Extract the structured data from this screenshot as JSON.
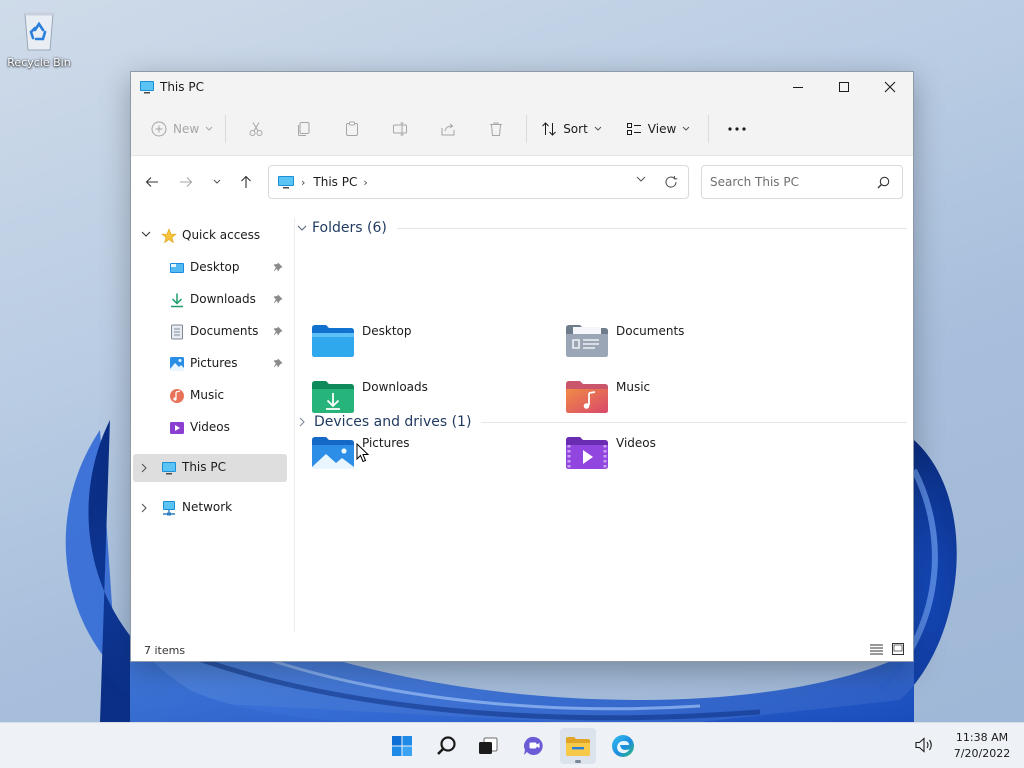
{
  "desktop": {
    "recycle_bin_label": "Recycle Bin"
  },
  "window": {
    "title": "This PC",
    "toolbar": {
      "new_label": "New",
      "sort_label": "Sort",
      "view_label": "View",
      "disabled_icons": [
        "cut-icon",
        "copy-icon",
        "paste-icon",
        "rename-icon",
        "share-icon",
        "delete-icon"
      ]
    },
    "address": {
      "crumb": "This PC",
      "search_placeholder": "Search This PC"
    },
    "navpane": {
      "quick_access": "Quick access",
      "items": [
        {
          "label": "Desktop",
          "pinned": true
        },
        {
          "label": "Downloads",
          "pinned": true
        },
        {
          "label": "Documents",
          "pinned": true
        },
        {
          "label": "Pictures",
          "pinned": true
        },
        {
          "label": "Music",
          "pinned": false
        },
        {
          "label": "Videos",
          "pinned": false
        }
      ],
      "this_pc": "This PC",
      "network": "Network"
    },
    "content": {
      "folders_header": "Folders (6)",
      "folders": [
        {
          "name": "Desktop",
          "icon": "desktop-folder-icon"
        },
        {
          "name": "Documents",
          "icon": "documents-folder-icon"
        },
        {
          "name": "Downloads",
          "icon": "downloads-folder-icon"
        },
        {
          "name": "Music",
          "icon": "music-folder-icon"
        },
        {
          "name": "Pictures",
          "icon": "pictures-folder-icon"
        },
        {
          "name": "Videos",
          "icon": "videos-folder-icon"
        }
      ],
      "devices_header": "Devices and drives (1)"
    },
    "status": {
      "item_count": "7 items"
    }
  },
  "taskbar": {
    "apps": [
      "start-icon",
      "search-icon",
      "task-view-icon",
      "chat-icon",
      "file-explorer-icon",
      "edge-icon"
    ],
    "clock_time": "11:38 AM",
    "clock_date": "7/20/2022"
  },
  "colors": {
    "accent": "#0067c0",
    "selection": "#dedede",
    "taskbar": "#eef1f6"
  }
}
